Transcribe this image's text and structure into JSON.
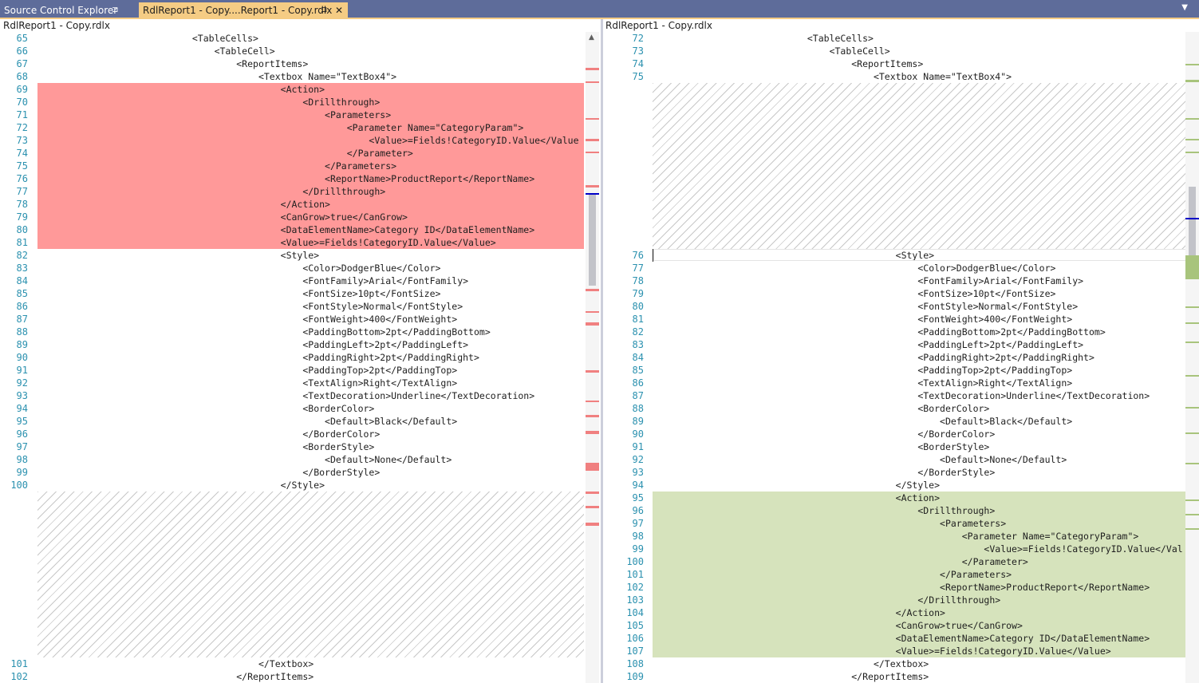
{
  "tabs": [
    {
      "label": "Source Control Explorer",
      "pin": "⊐",
      "active": false
    },
    {
      "label": "RdlReport1 - Copy....Report1 - Copy.rdlx",
      "pin": "⊐",
      "close": "✕",
      "active": true
    }
  ],
  "overflow_icon": "chevron-down-icon",
  "left_pane": {
    "header": "RdlReport1 - Copy.rdlx",
    "lines": [
      {
        "num": "65",
        "indent": 28,
        "text": "<TableCells>"
      },
      {
        "num": "66",
        "indent": 32,
        "text": "<TableCell>"
      },
      {
        "num": "67",
        "indent": 36,
        "text": "<ReportItems>"
      },
      {
        "num": "68",
        "indent": 40,
        "text": "<Textbox Name=\"TextBox4\">"
      },
      {
        "num": "69",
        "indent": 44,
        "text": "<Action>",
        "status": "removed"
      },
      {
        "num": "70",
        "indent": 48,
        "text": "<Drillthrough>",
        "status": "removed"
      },
      {
        "num": "71",
        "indent": 52,
        "text": "<Parameters>",
        "status": "removed"
      },
      {
        "num": "72",
        "indent": 56,
        "text": "<Parameter Name=\"CategoryParam\">",
        "status": "removed"
      },
      {
        "num": "73",
        "indent": 60,
        "text": "<Value>=Fields!CategoryID.Value</Value",
        "status": "removed"
      },
      {
        "num": "74",
        "indent": 56,
        "text": "</Parameter>",
        "status": "removed"
      },
      {
        "num": "75",
        "indent": 52,
        "text": "</Parameters>",
        "status": "removed"
      },
      {
        "num": "76",
        "indent": 52,
        "text": "<ReportName>ProductReport</ReportName>",
        "status": "removed"
      },
      {
        "num": "77",
        "indent": 48,
        "text": "</Drillthrough>",
        "status": "removed"
      },
      {
        "num": "78",
        "indent": 44,
        "text": "</Action>",
        "status": "removed"
      },
      {
        "num": "79",
        "indent": 44,
        "text": "<CanGrow>true</CanGrow>",
        "status": "removed"
      },
      {
        "num": "80",
        "indent": 44,
        "text": "<DataElementName>Category ID</DataElementName>",
        "status": "removed"
      },
      {
        "num": "81",
        "indent": 44,
        "text": "<Value>=Fields!CategoryID.Value</Value>",
        "status": "removed"
      },
      {
        "num": "82",
        "indent": 44,
        "text": "<Style>"
      },
      {
        "num": "83",
        "indent": 48,
        "text": "<Color>DodgerBlue</Color>"
      },
      {
        "num": "84",
        "indent": 48,
        "text": "<FontFamily>Arial</FontFamily>"
      },
      {
        "num": "85",
        "indent": 48,
        "text": "<FontSize>10pt</FontSize>"
      },
      {
        "num": "86",
        "indent": 48,
        "text": "<FontStyle>Normal</FontStyle>"
      },
      {
        "num": "87",
        "indent": 48,
        "text": "<FontWeight>400</FontWeight>"
      },
      {
        "num": "88",
        "indent": 48,
        "text": "<PaddingBottom>2pt</PaddingBottom>"
      },
      {
        "num": "89",
        "indent": 48,
        "text": "<PaddingLeft>2pt</PaddingLeft>"
      },
      {
        "num": "90",
        "indent": 48,
        "text": "<PaddingRight>2pt</PaddingRight>"
      },
      {
        "num": "91",
        "indent": 48,
        "text": "<PaddingTop>2pt</PaddingTop>"
      },
      {
        "num": "92",
        "indent": 48,
        "text": "<TextAlign>Right</TextAlign>"
      },
      {
        "num": "93",
        "indent": 48,
        "text": "<TextDecoration>Underline</TextDecoration>"
      },
      {
        "num": "94",
        "indent": 48,
        "text": "<BorderColor>"
      },
      {
        "num": "95",
        "indent": 52,
        "text": "<Default>Black</Default>"
      },
      {
        "num": "96",
        "indent": 48,
        "text": "</BorderColor>"
      },
      {
        "num": "97",
        "indent": 48,
        "text": "<BorderStyle>"
      },
      {
        "num": "98",
        "indent": 52,
        "text": "<Default>None</Default>"
      },
      {
        "num": "99",
        "indent": 48,
        "text": "</BorderStyle>"
      },
      {
        "num": "100",
        "indent": 44,
        "text": "</Style>"
      },
      {
        "num": "",
        "indent": 0,
        "text": "",
        "status": "placeholder"
      },
      {
        "num": "",
        "indent": 0,
        "text": "",
        "status": "placeholder"
      },
      {
        "num": "",
        "indent": 0,
        "text": "",
        "status": "placeholder"
      },
      {
        "num": "",
        "indent": 0,
        "text": "",
        "status": "placeholder"
      },
      {
        "num": "",
        "indent": 0,
        "text": "",
        "status": "placeholder"
      },
      {
        "num": "",
        "indent": 0,
        "text": "",
        "status": "placeholder"
      },
      {
        "num": "",
        "indent": 0,
        "text": "",
        "status": "placeholder"
      },
      {
        "num": "",
        "indent": 0,
        "text": "",
        "status": "placeholder"
      },
      {
        "num": "",
        "indent": 0,
        "text": "",
        "status": "placeholder"
      },
      {
        "num": "",
        "indent": 0,
        "text": "",
        "status": "placeholder"
      },
      {
        "num": "",
        "indent": 0,
        "text": "",
        "status": "placeholder"
      },
      {
        "num": "",
        "indent": 0,
        "text": "",
        "status": "placeholder"
      },
      {
        "num": "",
        "indent": 0,
        "text": "",
        "status": "placeholder"
      },
      {
        "num": "101",
        "indent": 40,
        "text": "</Textbox>"
      },
      {
        "num": "102",
        "indent": 36,
        "text": "</ReportItems>"
      }
    ]
  },
  "right_pane": {
    "header": "RdlReport1 - Copy.rdlx",
    "lines": [
      {
        "num": "72",
        "indent": 28,
        "text": "<TableCells>"
      },
      {
        "num": "73",
        "indent": 32,
        "text": "<TableCell>"
      },
      {
        "num": "74",
        "indent": 36,
        "text": "<ReportItems>"
      },
      {
        "num": "75",
        "indent": 40,
        "text": "<Textbox Name=\"TextBox4\">"
      },
      {
        "num": "",
        "indent": 0,
        "text": "",
        "status": "placeholder"
      },
      {
        "num": "",
        "indent": 0,
        "text": "",
        "status": "placeholder"
      },
      {
        "num": "",
        "indent": 0,
        "text": "",
        "status": "placeholder"
      },
      {
        "num": "",
        "indent": 0,
        "text": "",
        "status": "placeholder"
      },
      {
        "num": "",
        "indent": 0,
        "text": "",
        "status": "placeholder"
      },
      {
        "num": "",
        "indent": 0,
        "text": "",
        "status": "placeholder"
      },
      {
        "num": "",
        "indent": 0,
        "text": "",
        "status": "placeholder"
      },
      {
        "num": "",
        "indent": 0,
        "text": "",
        "status": "placeholder"
      },
      {
        "num": "",
        "indent": 0,
        "text": "",
        "status": "placeholder"
      },
      {
        "num": "",
        "indent": 0,
        "text": "",
        "status": "placeholder"
      },
      {
        "num": "",
        "indent": 0,
        "text": "",
        "status": "placeholder"
      },
      {
        "num": "",
        "indent": 0,
        "text": "",
        "status": "placeholder"
      },
      {
        "num": "",
        "indent": 0,
        "text": "",
        "status": "placeholder"
      },
      {
        "num": "76",
        "indent": 44,
        "text": "<Style>",
        "current": true
      },
      {
        "num": "77",
        "indent": 48,
        "text": "<Color>DodgerBlue</Color>"
      },
      {
        "num": "78",
        "indent": 48,
        "text": "<FontFamily>Arial</FontFamily>"
      },
      {
        "num": "79",
        "indent": 48,
        "text": "<FontSize>10pt</FontSize>"
      },
      {
        "num": "80",
        "indent": 48,
        "text": "<FontStyle>Normal</FontStyle>"
      },
      {
        "num": "81",
        "indent": 48,
        "text": "<FontWeight>400</FontWeight>"
      },
      {
        "num": "82",
        "indent": 48,
        "text": "<PaddingBottom>2pt</PaddingBottom>"
      },
      {
        "num": "83",
        "indent": 48,
        "text": "<PaddingLeft>2pt</PaddingLeft>"
      },
      {
        "num": "84",
        "indent": 48,
        "text": "<PaddingRight>2pt</PaddingRight>"
      },
      {
        "num": "85",
        "indent": 48,
        "text": "<PaddingTop>2pt</PaddingTop>"
      },
      {
        "num": "86",
        "indent": 48,
        "text": "<TextAlign>Right</TextAlign>"
      },
      {
        "num": "87",
        "indent": 48,
        "text": "<TextDecoration>Underline</TextDecoration>"
      },
      {
        "num": "88",
        "indent": 48,
        "text": "<BorderColor>"
      },
      {
        "num": "89",
        "indent": 52,
        "text": "<Default>Black</Default>"
      },
      {
        "num": "90",
        "indent": 48,
        "text": "</BorderColor>"
      },
      {
        "num": "91",
        "indent": 48,
        "text": "<BorderStyle>"
      },
      {
        "num": "92",
        "indent": 52,
        "text": "<Default>None</Default>"
      },
      {
        "num": "93",
        "indent": 48,
        "text": "</BorderStyle>"
      },
      {
        "num": "94",
        "indent": 44,
        "text": "</Style>"
      },
      {
        "num": "95",
        "indent": 44,
        "text": "<Action>",
        "status": "added"
      },
      {
        "num": "96",
        "indent": 48,
        "text": "<Drillthrough>",
        "status": "added"
      },
      {
        "num": "97",
        "indent": 52,
        "text": "<Parameters>",
        "status": "added"
      },
      {
        "num": "98",
        "indent": 56,
        "text": "<Parameter Name=\"CategoryParam\">",
        "status": "added"
      },
      {
        "num": "99",
        "indent": 60,
        "text": "<Value>=Fields!CategoryID.Value</Val",
        "status": "added"
      },
      {
        "num": "100",
        "indent": 56,
        "text": "</Parameter>",
        "status": "added"
      },
      {
        "num": "101",
        "indent": 52,
        "text": "</Parameters>",
        "status": "added"
      },
      {
        "num": "102",
        "indent": 52,
        "text": "<ReportName>ProductReport</ReportName>",
        "status": "added"
      },
      {
        "num": "103",
        "indent": 48,
        "text": "</Drillthrough>",
        "status": "added"
      },
      {
        "num": "104",
        "indent": 44,
        "text": "</Action>",
        "status": "added"
      },
      {
        "num": "105",
        "indent": 44,
        "text": "<CanGrow>true</CanGrow>",
        "status": "added"
      },
      {
        "num": "106",
        "indent": 44,
        "text": "<DataElementName>Category ID</DataElementName>",
        "status": "added"
      },
      {
        "num": "107",
        "indent": 44,
        "text": "<Value>=Fields!CategoryID.Value</Value>",
        "status": "added"
      },
      {
        "num": "108",
        "indent": 40,
        "text": "</Textbox>"
      },
      {
        "num": "109",
        "indent": 36,
        "text": "</ReportItems>"
      }
    ]
  },
  "colors": {
    "tab_bar": "#5e6c9a",
    "active_tab": "#f5cc84",
    "removed": "#ff9999",
    "added": "#d6e3bc",
    "line_number": "#2b91af"
  },
  "scroll_up_icon": "▲"
}
